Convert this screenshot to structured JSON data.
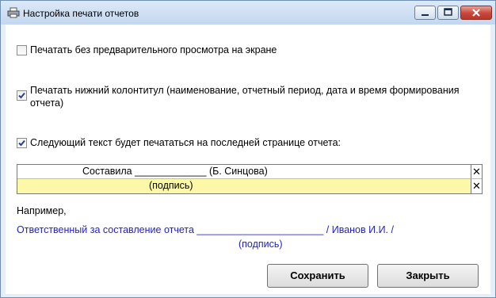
{
  "window": {
    "title": "Настройка печати отчетов"
  },
  "options": {
    "no_preview": {
      "label": "Печатать без предварительного просмотра на экране",
      "checked": false
    },
    "footer": {
      "label_line1": "Печатать нижний колонтитул (наименование, отчетный период, дата и время формирования",
      "label_line2": "отчета)",
      "checked": true
    },
    "last_page_text": {
      "label": "Следующий текст будет печататься на последней странице отчета:",
      "checked": true
    }
  },
  "last_page_rows": [
    {
      "text": "Составила _____________ (Б. Синцова)",
      "delete": "✕"
    },
    {
      "text": "(подпись)",
      "delete": "✕"
    }
  ],
  "example": {
    "heading": "Например,",
    "line1": "Ответственный за составление отчета   _______________________ / Иванов И.И. /",
    "line2": "(подпись)"
  },
  "buttons": {
    "save": "Сохранить",
    "close": "Закрыть"
  },
  "colors": {
    "highlight_row": "#fdf8a8",
    "example_text": "#1f1fc8"
  }
}
